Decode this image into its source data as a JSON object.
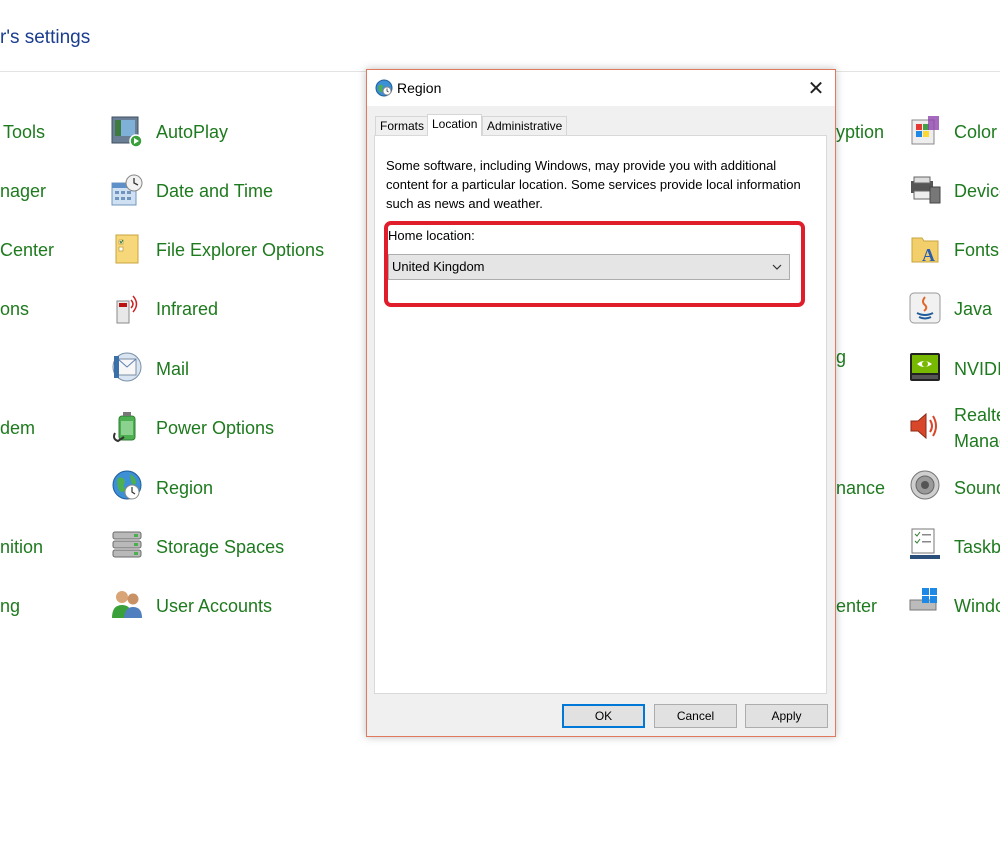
{
  "page": {
    "heading": "r's settings"
  },
  "left_col": [
    {
      "label": "Tools"
    },
    {
      "label": "nager"
    },
    {
      "label": "Center"
    },
    {
      "label": "ons"
    },
    {
      "label": "dem"
    },
    {
      "label": "nition"
    },
    {
      "label": "ng"
    }
  ],
  "middle_col": [
    {
      "label": "AutoPlay",
      "icon": "autoplay-icon"
    },
    {
      "label": "Date and Time",
      "icon": "date-time-icon"
    },
    {
      "label": "File Explorer Options",
      "icon": "file-explorer-options-icon"
    },
    {
      "label": "Infrared",
      "icon": "infrared-icon"
    },
    {
      "label": "Mail",
      "icon": "mail-icon"
    },
    {
      "label": "Power Options",
      "icon": "power-options-icon"
    },
    {
      "label": "Region",
      "icon": "region-icon"
    },
    {
      "label": "Storage Spaces",
      "icon": "storage-spaces-icon"
    },
    {
      "label": "User Accounts",
      "icon": "user-accounts-icon"
    }
  ],
  "right_partial": [
    {
      "label": "yption"
    },
    {
      "label": "g"
    },
    {
      "label": "nance"
    },
    {
      "label": "enter"
    }
  ],
  "far_right": [
    {
      "label": "Color",
      "icon": "color-icon"
    },
    {
      "label": "Device",
      "icon": "devices-icon"
    },
    {
      "label": "Fonts",
      "icon": "fonts-icon"
    },
    {
      "label": "Java",
      "icon": "java-icon"
    },
    {
      "label": "NVIDI",
      "icon": "nvidia-icon"
    },
    {
      "label": "Realte",
      "label2": "Manag",
      "icon": "speaker-icon"
    },
    {
      "label": "Sound",
      "icon": "sound-icon"
    },
    {
      "label": "Taskba",
      "icon": "taskbar-icon"
    },
    {
      "label": "Windo",
      "icon": "windows-icon"
    }
  ],
  "dialog": {
    "title": "Region",
    "close_glyph": "✕",
    "tabs": [
      {
        "label": "Formats"
      },
      {
        "label": "Location"
      },
      {
        "label": "Administrative"
      }
    ],
    "active_tab": "Location",
    "description": "Some software, including Windows, may provide you with additional content for a particular location. Some services provide local information such as news and weather.",
    "home_location_label": "Home location:",
    "home_location_value": "United Kingdom",
    "buttons": {
      "ok": "OK",
      "cancel": "Cancel",
      "apply": "Apply"
    }
  },
  "colors": {
    "link_green": "#1e7a1e",
    "heading_blue": "#1a3d8f",
    "highlight_red": "#e01e2b",
    "ok_border": "#0078d7"
  }
}
